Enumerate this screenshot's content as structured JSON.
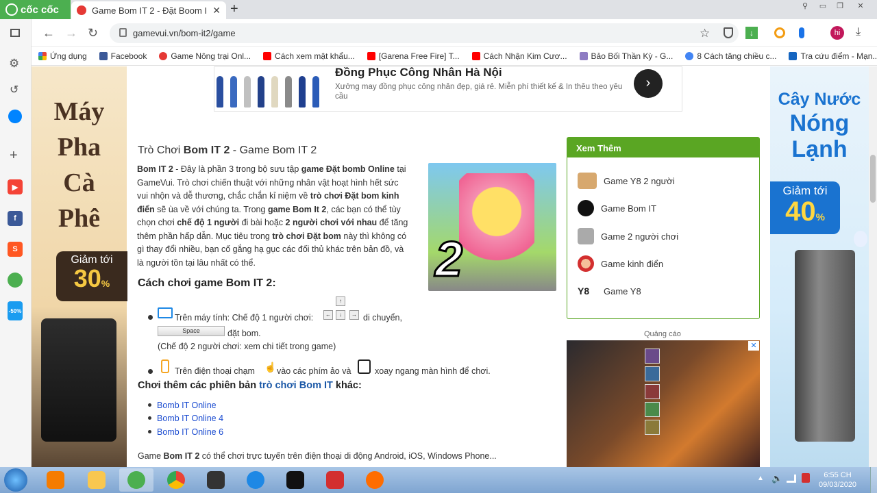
{
  "browser": {
    "brand": "cốc cốc",
    "tab_title": "Game Bom IT 2 - Đặt Boom I",
    "url": "gamevui.vn/bom-it2/game",
    "profile_initials": "hi",
    "bookmarks": [
      {
        "label": "Ứng dụng",
        "icon": "apps-grid-icon"
      },
      {
        "label": "Facebook",
        "icon": "facebook-icon"
      },
      {
        "label": "Game Nông trại Onl...",
        "icon": "coccoc-icon"
      },
      {
        "label": "Cách xem mật khẩu...",
        "icon": "youtube-icon"
      },
      {
        "label": "[Garena Free Fire] T...",
        "icon": "youtube-icon"
      },
      {
        "label": "Cách Nhận Kim Cươ...",
        "icon": "youtube-icon"
      },
      {
        "label": "Bảo Bối Thần Kỳ - G...",
        "icon": "gem-icon"
      },
      {
        "label": "8 Cách tăng chiều c...",
        "icon": "google-icon"
      },
      {
        "label": "Tra cứu điểm - Mạn...",
        "icon": "doc-icon"
      }
    ]
  },
  "ads": {
    "top_title": "Đồng Phục Công Nhân Hà Nội",
    "top_desc": "Xưởng may đồng phục công nhân đẹp, giá rẻ. Miễn phí thiết kế & In thêu theo yêu cầu",
    "left_line1": "Máy",
    "left_line2": "Pha",
    "left_line3": "Cà",
    "left_line4": "Phê",
    "left_discount_label": "Giảm tới",
    "left_discount_value": "30",
    "right_line1": "Cây Nước",
    "right_line2": "Nóng",
    "right_line3": "Lạnh",
    "right_discount_label": "Giảm tới",
    "right_discount_value": "40",
    "plus_sign": "++",
    "percent_sign": "%",
    "ad_label": "Quảng cáo"
  },
  "article": {
    "title_prefix": "Trò Chơi ",
    "title_bold": "Bom IT 2",
    "title_suffix": " - Game Bom IT 2",
    "intro": [
      {
        "b": "Bom IT 2"
      },
      {
        "t": " - Đây là phần 3 trong bộ sưu tập "
      },
      {
        "b": "game Đặt bomb Online"
      },
      {
        "t": " tại GameVui. Trò chơi chiến thuật với những nhân vật hoạt hình hết sức vui nhộn và dễ thương, chắc chắn kỉ niệm về "
      },
      {
        "b": "trò chơi Đặt bom kinh điển"
      },
      {
        "t": " sẽ ùa về với chúng ta. Trong "
      },
      {
        "b": "game Bom It 2"
      },
      {
        "t": ", các bạn có thể tùy chọn chơi "
      },
      {
        "b": "chế độ 1 người"
      },
      {
        "t": " đi bài hoặc "
      },
      {
        "b": "2 người chơi với nhau"
      },
      {
        "t": " để tăng thêm phần hấp dẫn. Mục tiêu trong "
      },
      {
        "b": "trò chơi Đặt bom"
      },
      {
        "t": " này thì không có gì thay đổi nhiều, bạn cố gắng hạ gục các đối thủ khác trên bản đồ, và là người tồn tại lâu nhất có thể."
      }
    ],
    "game_number": "2",
    "howto_heading": "Cách chơi game Bom IT 2:",
    "pc_text": "Trên máy tính: Chế độ 1 người chơi:",
    "move_text": "di chuyển,",
    "space_label": "Space",
    "bomb_text": "đặt bom.",
    "two_player_note": "(Chế độ 2 người chơi: xem chi tiết trong game)",
    "phone_text_a": "Trên điện thoại chạm",
    "phone_text_b": "vào các phím ảo và",
    "phone_text_c": "xoay ngang màn hình để chơi.",
    "more_prefix": "Chơi thêm các phiên bản ",
    "more_link": "trò chơi Bom IT",
    "more_suffix": " khác:",
    "versions": [
      "Bomb IT Online",
      "Bomb IT Online 4",
      "Bomb IT Online 6"
    ],
    "footer_a": "Game ",
    "footer_bold": "Bom IT 2",
    "footer_b": " có thể chơi trực tuyến trên điện thoại di động Android, iOS, Windows Phone..."
  },
  "sidebox": {
    "heading": "Xem Thêm",
    "items": [
      "Game Y8 2 người",
      "Game Bom IT",
      "Game 2 người chơi",
      "Game kinh điển",
      "Game Y8"
    ],
    "y8_logo": "Y8"
  },
  "taskbar": {
    "time": "6:55 CH",
    "date": "09/03/2020"
  },
  "colors": {
    "accent_green": "#5aa623",
    "link_blue": "#1a4bd0",
    "coccoc_green": "#4caf50"
  }
}
